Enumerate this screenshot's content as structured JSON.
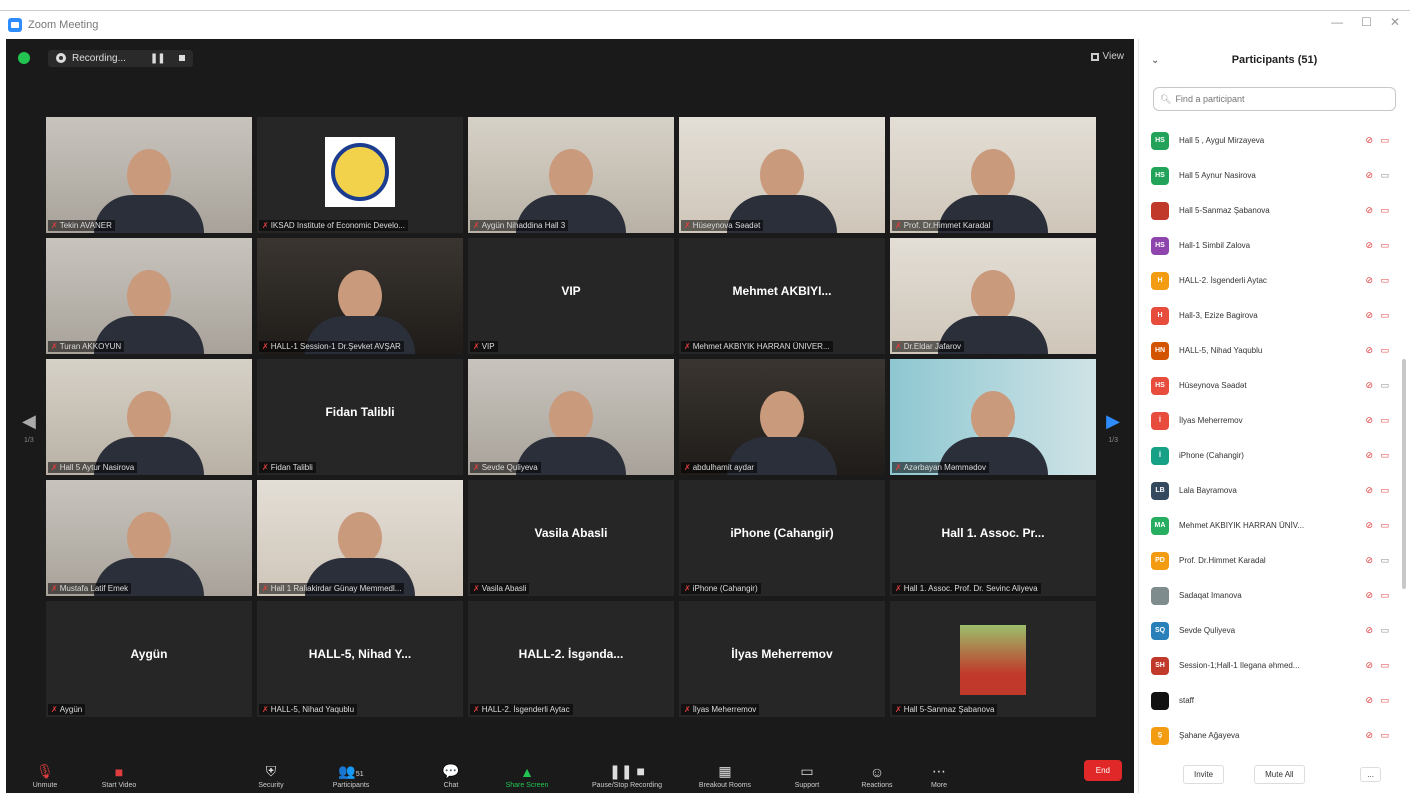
{
  "window": {
    "title": "Zoom Meeting",
    "controls": [
      "—",
      "☐",
      "✕"
    ]
  },
  "meeting_bar": {
    "recording_label": "Recording...",
    "view_label": "View"
  },
  "tiles": [
    {
      "label": "Tekin AVANER",
      "center_name": "",
      "bg": "bg-room1",
      "kind": "person"
    },
    {
      "label": "IKSAD Institute of Economic Develo...",
      "center_name": "",
      "bg": "",
      "kind": "logo"
    },
    {
      "label": "Aygün Nihaddina Hall 3",
      "center_name": "",
      "bg": "bg-room2",
      "kind": "person"
    },
    {
      "label": "Hüseynova Səadət",
      "center_name": "",
      "bg": "bg-room3",
      "kind": "person"
    },
    {
      "label": "Prof. Dr.Himmet Karadal",
      "center_name": "",
      "bg": "bg-room3",
      "kind": "person"
    },
    {
      "label": "Turan AKKOYUN",
      "center_name": "",
      "bg": "bg-room1",
      "kind": "person"
    },
    {
      "label": "HALL-1 Session-1 Dr.Şevket AVŞAR",
      "center_name": "",
      "bg": "bg-dark",
      "kind": "person"
    },
    {
      "label": "VIP",
      "center_name": "VIP",
      "bg": "",
      "kind": "name"
    },
    {
      "label": "Mehmet AKBIYIK HARRAN ÜNIVER...",
      "center_name": "Mehmet AKBIYI...",
      "bg": "",
      "kind": "name"
    },
    {
      "label": "Dr.Eldar Jafarov",
      "center_name": "",
      "bg": "bg-room3",
      "kind": "person"
    },
    {
      "label": "Hall 5 Aytur Nasirova",
      "center_name": "",
      "bg": "bg-room2",
      "kind": "person"
    },
    {
      "label": "Fidan Talibli",
      "center_name": "Fidan Talibli",
      "bg": "",
      "kind": "name"
    },
    {
      "label": "Sevde Quliyeva",
      "center_name": "",
      "bg": "bg-room1",
      "kind": "person"
    },
    {
      "label": "abdulhamit aydar",
      "center_name": "",
      "bg": "bg-dark",
      "kind": "person"
    },
    {
      "label": "Azərbayan Məmmədov",
      "center_name": "",
      "bg": "bg-blue",
      "kind": "person",
      "active": true
    },
    {
      "label": "Mustafa Latif Emek",
      "center_name": "",
      "bg": "bg-room1",
      "kind": "person"
    },
    {
      "label": "Hall 1 Raliakirdar Günay Memmedl...",
      "center_name": "",
      "bg": "bg-room3",
      "kind": "person"
    },
    {
      "label": "Vasila Abasli",
      "center_name": "Vasila Abasli",
      "bg": "",
      "kind": "name"
    },
    {
      "label": "iPhone (Cahangir)",
      "center_name": "iPhone (Cahangir)",
      "bg": "",
      "kind": "name"
    },
    {
      "label": "Hall 1. Assoc. Prof. Dr. Sevinc Aliyeva",
      "center_name": "Hall 1. Assoc. Pr...",
      "bg": "",
      "kind": "name"
    },
    {
      "label": "Aygün",
      "center_name": "Aygün",
      "bg": "",
      "kind": "name"
    },
    {
      "label": "HALL-5, Nihad Yaqublu",
      "center_name": "HALL-5, Nihad Y...",
      "bg": "",
      "kind": "name"
    },
    {
      "label": "HALL-2. İsgenderli Aytac",
      "center_name": "HALL-2. İsgənda...",
      "bg": "",
      "kind": "name"
    },
    {
      "label": "İlyas Meherremov",
      "center_name": "İlyas Meherremov",
      "bg": "",
      "kind": "name"
    },
    {
      "label": "Hall 5-Sanmaz Şabanova",
      "center_name": "",
      "bg": "",
      "kind": "photo"
    }
  ],
  "pager": {
    "left": "1/3",
    "right": "1/3"
  },
  "toolbar": {
    "unmute": "Unmute",
    "start_video": "Start Video",
    "security": "Security",
    "participants": "Participants",
    "participants_count": "51",
    "chat": "Chat",
    "share_screen": "Share Screen",
    "pause_recording": "Pause/Stop Recording",
    "breakout": "Breakout Rooms",
    "support": "Support",
    "reactions": "Reactions",
    "more": "More",
    "end": "End"
  },
  "panel": {
    "title": "Participants (51)",
    "search_placeholder": "Find a participant",
    "participants": [
      {
        "initials": "HS",
        "color": "#23a35a",
        "name": "Hall 5 , Aygul Mirzayeva",
        "cam": "off"
      },
      {
        "initials": "HS",
        "color": "#23a35a",
        "name": "Hall 5 Aynur Nasirova",
        "cam": "on"
      },
      {
        "initials": "",
        "color": "#c0392b",
        "name": "Hall 5-Sanmaz Şabanova",
        "cam": "off"
      },
      {
        "initials": "HS",
        "color": "#8e44ad",
        "name": "Hall-1 Simbil Zalova",
        "cam": "off"
      },
      {
        "initials": "H",
        "color": "#f39c12",
        "name": "HALL-2. İsgenderli Aytac",
        "cam": "off"
      },
      {
        "initials": "H",
        "color": "#e74c3c",
        "name": "Hall-3, Ezize Bagirova",
        "cam": "off"
      },
      {
        "initials": "HN",
        "color": "#d35400",
        "name": "HALL-5, Nihad Yaqublu",
        "cam": "off"
      },
      {
        "initials": "HS",
        "color": "#e74c3c",
        "name": "Hüseynova Səadət",
        "cam": "on"
      },
      {
        "initials": "İ",
        "color": "#e74c3c",
        "name": "İlyas Meherremov",
        "cam": "off"
      },
      {
        "initials": "İ",
        "color": "#16a085",
        "name": "iPhone (Cahangir)",
        "cam": "off"
      },
      {
        "initials": "LB",
        "color": "#34495e",
        "name": "Lala Bayramova",
        "cam": "off"
      },
      {
        "initials": "MA",
        "color": "#27ae60",
        "name": "Mehmet AKBIYIK HARRAN ÜNİV...",
        "cam": "off"
      },
      {
        "initials": "PD",
        "color": "#f39c12",
        "name": "Prof. Dr.Himmet Karadal",
        "cam": "on"
      },
      {
        "initials": "",
        "color": "#7f8c8d",
        "name": "Sadaqat Imanova",
        "cam": "off"
      },
      {
        "initials": "SQ",
        "color": "#2980b9",
        "name": "Sevde Quliyeva",
        "cam": "on"
      },
      {
        "initials": "SH",
        "color": "#c0392b",
        "name": "Session-1;Hall-1 Ilegana əhmed...",
        "cam": "off"
      },
      {
        "initials": "",
        "color": "#111111",
        "name": "staff",
        "cam": "off"
      },
      {
        "initials": "Ş",
        "color": "#f39c12",
        "name": "Şahane Ağayeva",
        "cam": "off"
      }
    ],
    "invite": "Invite",
    "mute_all": "Mute All",
    "more": "..."
  }
}
